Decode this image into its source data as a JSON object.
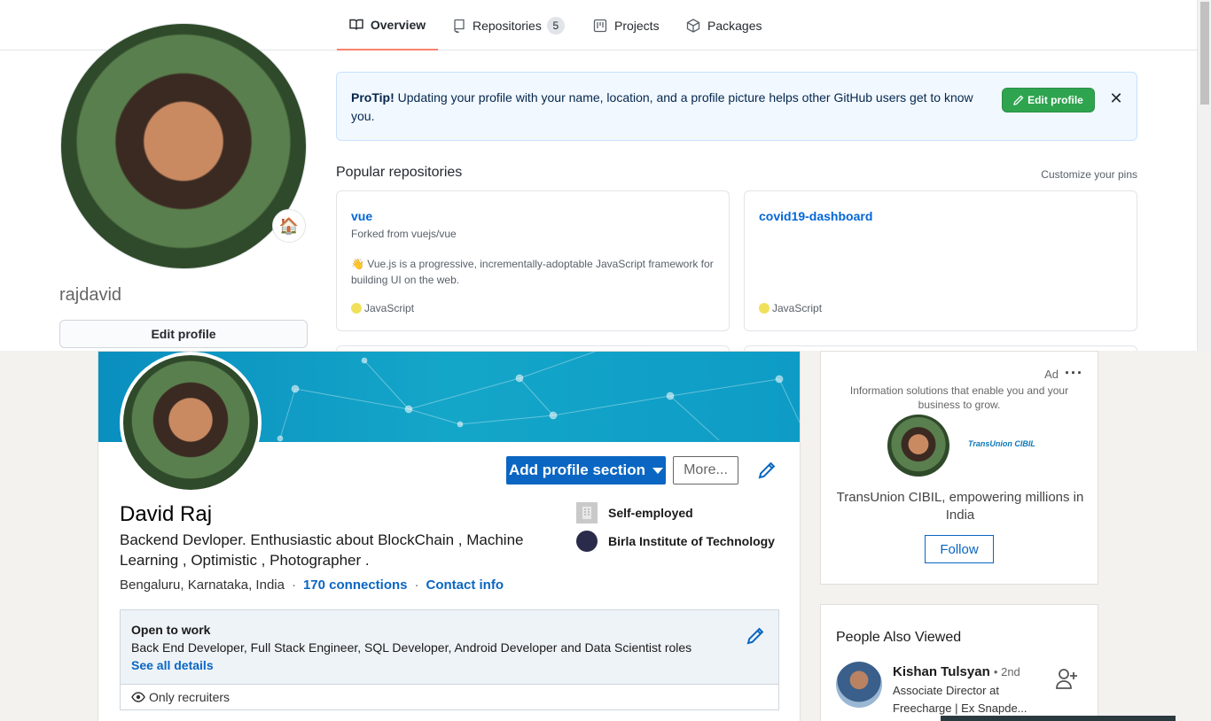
{
  "github": {
    "tabs": [
      {
        "label": "Overview",
        "icon": "book-icon"
      },
      {
        "label": "Repositories",
        "icon": "repo-icon",
        "count": "5"
      },
      {
        "label": "Projects",
        "icon": "project-icon"
      },
      {
        "label": "Packages",
        "icon": "package-icon"
      }
    ],
    "username": "rajdavid",
    "edit_profile_label": "Edit profile",
    "status_icon": "house-emoji",
    "protip": {
      "bold": "ProTip!",
      "text": "Updating your profile with your name, location, and a profile picture helps other GitHub users get to know you.",
      "button": "Edit profile",
      "close": "✕"
    },
    "popular_title": "Popular repositories",
    "customize_label": "Customize your pins",
    "repos": [
      {
        "name": "vue",
        "fork": "Forked from vuejs/vue",
        "emoji": "👋",
        "description": "Vue.js is a progressive, incrementally-adoptable JavaScript framework for building UI on the web.",
        "language": "JavaScript",
        "language_color": "#f1e05a"
      },
      {
        "name": "covid19-dashboard",
        "fork": "",
        "description": "",
        "language": "JavaScript",
        "language_color": "#f1e05a"
      }
    ]
  },
  "linkedin": {
    "add_section_label": "Add profile section",
    "more_label": "More...",
    "name": "David Raj",
    "headline": "Backend Devloper. Enthusiastic about BlockChain , Machine Learning , Optimistic , Photographer .",
    "location": "Bengaluru, Karnataka, India",
    "connections": "170 connections",
    "contact": "Contact info",
    "experience": [
      {
        "label": "Self-employed"
      },
      {
        "label": "Birla Institute of Technology"
      }
    ],
    "open_to_work": {
      "title": "Open to work",
      "roles": "Back End Developer, Full Stack Engineer, SQL Developer, Android Developer and Data Scientist roles",
      "link": "See all details",
      "visibility": "Only recruiters"
    },
    "ad": {
      "label": "Ad",
      "description": "Information solutions that enable you and your business to grow.",
      "brand": "TransUnion CIBIL",
      "tagline": "TransUnion CIBIL, empowering millions in India",
      "follow_label": "Follow"
    },
    "people_also_viewed": {
      "title": "People Also Viewed",
      "people": [
        {
          "name": "Kishan Tulsyan",
          "degree": "• 2nd",
          "role": "Associate Director at Freecharge | Ex Snapde..."
        }
      ]
    }
  },
  "colors": {
    "github_green": "#2ea44f",
    "github_link": "#0366d6",
    "linkedin_blue": "#0a66c2",
    "tab_underline": "#f9826c",
    "javascript": "#f1e05a"
  }
}
